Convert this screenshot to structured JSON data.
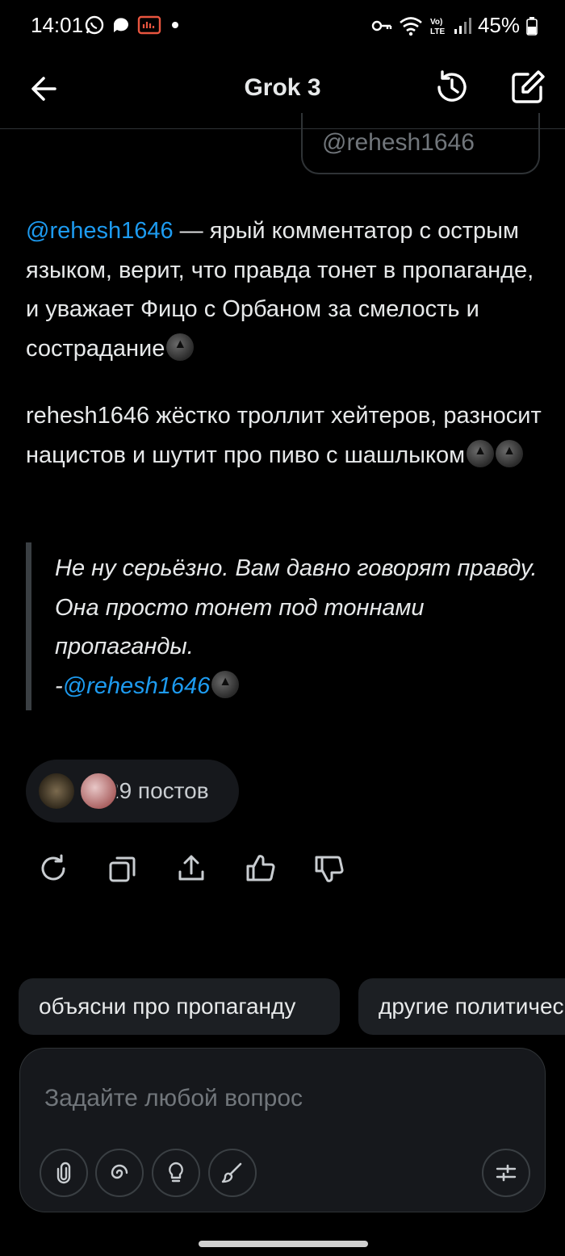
{
  "status_bar": {
    "time": "14:01",
    "battery": "45%"
  },
  "header": {
    "title": "Grok 3"
  },
  "user_message": {
    "text": "@rehesh1646"
  },
  "response": {
    "para1_mention": "@rehesh1646",
    "para1_text": " — ярый комментатор с острым языком, верит, что правда тонет в пропаганде, и уважает Фицо с Орбаном за смелость и сострадание",
    "para2_text": "rehesh1646 жёстко троллит хейтеров, разносит нацистов и шутит про пиво с шашлыком",
    "quote_text": "Не ну серьёзно. Вам давно говорят правду. Она просто тонет под тоннами пропаганды.",
    "quote_dash": "-",
    "quote_mention": "@rehesh1646"
  },
  "sources": {
    "label": "29 постов"
  },
  "actions": {
    "icons": [
      "regenerate-icon",
      "copy-icon",
      "share-icon",
      "thumbs-up-icon",
      "thumbs-down-icon"
    ]
  },
  "suggestions": [
    "объясни про пропаганду",
    "другие политические"
  ],
  "input": {
    "placeholder": "Задайте любой вопрос"
  },
  "colors": {
    "accent": "#1d9bf0",
    "background": "#000000",
    "text": "#e7e9ea",
    "muted": "#71767b"
  }
}
